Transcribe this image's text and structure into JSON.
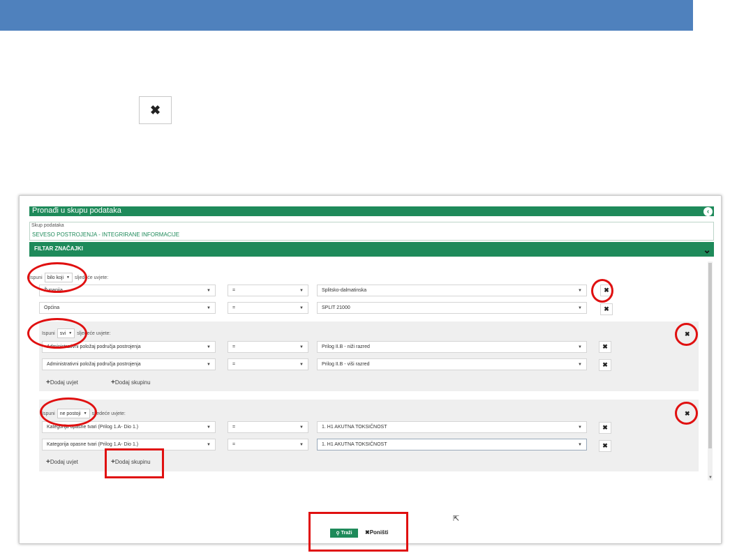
{
  "page": {
    "close_symbol": "✖"
  },
  "panel": {
    "title": "Pronađi u skupu podataka",
    "collapse_icon": "‹"
  },
  "dataset": {
    "label": "Skup podataka",
    "value": "SEVESO POSTROJENJA - INTEGRIRANE INFORMACIJE"
  },
  "filter": {
    "title": "FILTAR ZNAČAJKI",
    "chevron": "⌄"
  },
  "groups": [
    {
      "prefix": "Ispuni",
      "match": "bilo koji",
      "suffix": "sljedeće uvjete:",
      "conditions": [
        {
          "field": "Županija",
          "op": "=",
          "value": "Splitsko-dalmatinska"
        },
        {
          "field": "Općina",
          "op": "=",
          "value": "SPLIT 21000"
        }
      ]
    },
    {
      "prefix": "Ispuni",
      "match": "svi",
      "suffix": "sljedeće uvjete:",
      "conditions": [
        {
          "field": "Administrativni položaj područja postrojenja",
          "op": "=",
          "value": "Prilog II.B - niži razred"
        },
        {
          "field": "Administrativni položaj područja postrojenja",
          "op": "=",
          "value": "Prilog II.B - viši razred"
        }
      ],
      "add_condition": "Dodaj uvjet",
      "add_group": "Dodaj skupinu"
    },
    {
      "prefix": "Ispuni",
      "match": "ne postoji",
      "suffix": "sljedeće uvjete:",
      "conditions": [
        {
          "field": "Kategorija opasne tvari (Prilog 1.A- Dio 1.)",
          "op": "=",
          "value": "1. H1 AKUTNA TOKSIČNOST"
        },
        {
          "field": "Kategorija opasne tvari (Prilog 1.A- Dio 1.)",
          "op": "=",
          "value": "1. H1 AKUTNA TOKSIČNOST"
        }
      ],
      "add_condition": "Dodaj uvjet",
      "add_group": "Dodaj skupinu"
    }
  ],
  "actions": {
    "search": "Traži",
    "reset": "Poništi"
  },
  "colors": {
    "top_bar": "#4f81bd",
    "green": "#1e8a5a",
    "highlight_red": "#e01010"
  }
}
